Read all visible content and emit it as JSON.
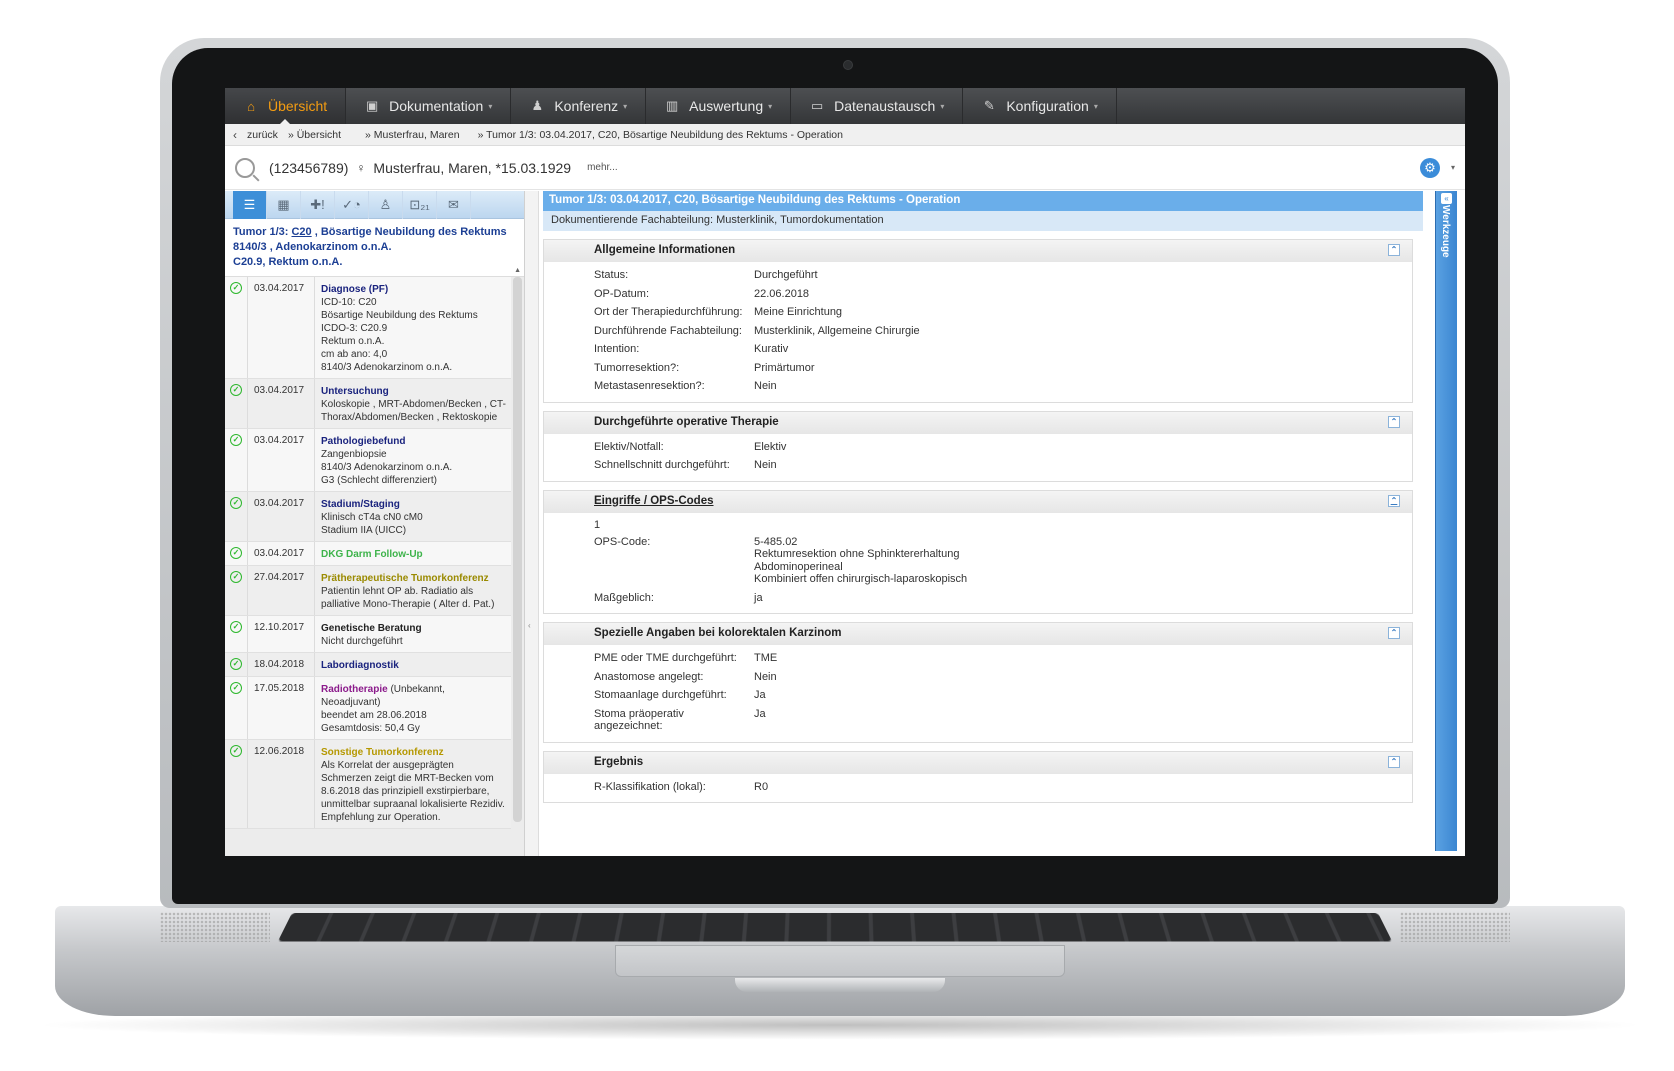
{
  "menu": [
    {
      "label": "Übersicht",
      "icon": "home-icon",
      "glyph": "⌂",
      "active": true
    },
    {
      "label": "Dokumentation",
      "icon": "document-icon",
      "glyph": "▣",
      "caret": true
    },
    {
      "label": "Konferenz",
      "icon": "people-icon",
      "glyph": "♟",
      "caret": true
    },
    {
      "label": "Auswertung",
      "icon": "bar-chart-icon",
      "glyph": "▥",
      "caret": true
    },
    {
      "label": "Datenaustausch",
      "icon": "folder-icon",
      "glyph": "▭",
      "caret": true
    },
    {
      "label": "Konfiguration",
      "icon": "wrench-icon",
      "glyph": "✎",
      "caret": true
    }
  ],
  "breadcrumb": {
    "back": "zurück",
    "items": [
      "» Übersicht",
      "» Musterfrau, Maren",
      "» Tumor 1/3: 03.04.2017, C20, Bösartige Neubildung des Rektums - Operation"
    ]
  },
  "patient": {
    "id": "(123456789)",
    "gender_symbol": "♀",
    "name": "Musterfrau, Maren, *15.03.1929",
    "more": "mehr..."
  },
  "left_toolbar": [
    {
      "icon": "list-icon",
      "glyph": "☰",
      "active": true
    },
    {
      "icon": "chart-icon",
      "glyph": "▦"
    },
    {
      "icon": "medical-alert-icon",
      "glyph": "✚!"
    },
    {
      "icon": "status-icon",
      "glyph": "✓◔"
    },
    {
      "icon": "person-icon",
      "glyph": "♙"
    },
    {
      "icon": "lock-count-icon",
      "glyph": "⊡₂₁"
    },
    {
      "icon": "mail-icon",
      "glyph": "✉"
    }
  ],
  "left_header": {
    "line1_prefix": "Tumor 1/3: ",
    "line1_code": "C20",
    "line1_suffix": " , Bösartige Neubildung des Rektums",
    "line2": "8140/3 , Adenokarzinom o.n.A.",
    "line3": "C20.9, Rektum o.n.A."
  },
  "entries": [
    {
      "date": "03.04.2017",
      "title": "Diagnose (PF)",
      "color": "c-darkblue",
      "lines": [
        "ICD-10: C20",
        "Bösartige Neubildung des Rektums",
        "ICDO-3: C20.9",
        "Rektum o.n.A.",
        "cm ab ano: 4,0",
        "8140/3 Adenokarzinom o.n.A."
      ]
    },
    {
      "date": "03.04.2017",
      "title": "Untersuchung",
      "color": "c-darkblue",
      "lines": [
        "Koloskopie , MRT-Abdomen/Becken , CT-Thorax/Abdomen/Becken , Rektoskopie"
      ]
    },
    {
      "date": "03.04.2017",
      "title": "Pathologiebefund",
      "color": "c-darkblue",
      "lines": [
        "Zangenbiopsie",
        "8140/3 Adenokarzinom o.n.A.",
        "G3 (Schlecht differenziert)"
      ]
    },
    {
      "date": "03.04.2017",
      "title": "Stadium/Staging",
      "color": "c-darkblue",
      "lines": [
        "Klinisch cT4a cN0 cM0",
        "Stadium IIA (UICC)"
      ]
    },
    {
      "date": "03.04.2017",
      "title": "DKG Darm Follow-Up",
      "color": "c-green",
      "lines": []
    },
    {
      "date": "27.04.2017",
      "title": "Prätherapeutische Tumorkonferenz",
      "color": "c-olive",
      "lines": [
        "Patientin lehnt OP ab. Radiatio als palliative Mono-Therapie ( Alter d. Pat.)"
      ]
    },
    {
      "date": "12.10.2017",
      "title": "Genetische Beratung",
      "color": "c-black",
      "lines": [
        "Nicht durchgeführt"
      ]
    },
    {
      "date": "18.04.2018",
      "title": "Labordiagnostik",
      "color": "c-darkblue",
      "lines": []
    },
    {
      "date": "17.05.2018",
      "title": "Radiotherapie",
      "title_suffix": " (Unbekannt, Neoadjuvant)",
      "color": "c-purple",
      "lines": [
        "beendet am 28.06.2018",
        "Gesamtdosis: 50,4 Gy"
      ]
    },
    {
      "date": "12.06.2018",
      "title": "Sonstige Tumorkonferenz",
      "color": "c-gold",
      "lines": [
        "Als Korrelat der ausgeprägten Schmerzen zeigt die MRT-Becken vom 8.6.2018 das prinzipiell exstirpierbare, unmittelbar supraanal lokalisierte Rezidiv. Empfehlung zur Operation."
      ]
    }
  ],
  "right": {
    "title": "Tumor 1/3: 03.04.2017, C20, Bösartige Neubildung des Rektums - Operation",
    "subtitle": "Dokumentierende Fachabteilung: Musterklinik, Tumordokumentation",
    "sections": [
      {
        "title": "Allgemeine Informationen",
        "rows": [
          {
            "label": "Status:",
            "value": "Durchgeführt"
          },
          {
            "label": "OP-Datum:",
            "value": "22.06.2018"
          },
          {
            "label": "Ort der Therapiedurchführung:",
            "value": "Meine Einrichtung"
          },
          {
            "label": "Durchführende Fachabteilung:",
            "value": "Musterklinik, Allgemeine Chirurgie"
          },
          {
            "label": "Intention:",
            "value": "Kurativ"
          },
          {
            "label": "Tumorresektion?:",
            "value": "Primärtumor"
          },
          {
            "label": "Metastasenresektion?:",
            "value": "Nein"
          }
        ]
      },
      {
        "title": "Durchgeführte operative Therapie",
        "rows": [
          {
            "label": "Elektiv/Notfall:",
            "value": "Elektiv"
          },
          {
            "label": "Schnellschnitt durchgeführt:",
            "value": "Nein"
          }
        ]
      },
      {
        "title": "Eingriffe / OPS-Codes",
        "underline": true,
        "index": "1",
        "rows": [
          {
            "label": "OPS-Code:",
            "value_lines": [
              "5-485.02",
              "Rektumresektion ohne Sphinktererhaltung",
              "Abdominoperineal",
              "Kombiniert offen chirurgisch-laparoskopisch"
            ]
          },
          {
            "label": "Maßgeblich:",
            "value": "ja"
          }
        ]
      },
      {
        "title": "Spezielle Angaben bei kolorektalen Karzinom",
        "rows": [
          {
            "label": "PME oder TME durchgeführt:",
            "value": "TME"
          },
          {
            "label": "Anastomose angelegt:",
            "value": "Nein"
          },
          {
            "label": "Stomaanlage durchgeführt:",
            "value": "Ja"
          },
          {
            "label": "Stoma präoperativ angezeichnet:",
            "value": "Ja"
          }
        ]
      },
      {
        "title": "Ergebnis",
        "rows": [
          {
            "label": "R-Klassifikation (lokal):",
            "value": "R0"
          }
        ]
      }
    ]
  },
  "werkzeuge_label": "Werkzeuge",
  "colors": {
    "accent_orange": "#f39c12",
    "header_blue": "#6aaeea",
    "sidebar_blue": "#3b86d1",
    "check_green": "#2eb82e"
  }
}
